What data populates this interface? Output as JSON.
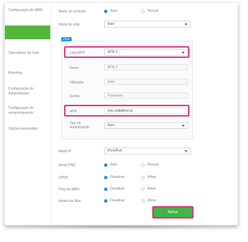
{
  "sidebar": {
    "items": [
      {
        "label": "Configuração de WAN"
      },
      {
        "label": ""
      },
      {
        "label": "Operadores de rede"
      },
      {
        "label": "Roaming"
      },
      {
        "label": "Configuração do Administrador"
      },
      {
        "label": "Configuração de armazenamento"
      },
      {
        "label": "Opções avançadas"
      }
    ]
  },
  "conn_mode": {
    "label": "Modo de conexão",
    "opt_auto": "Auto",
    "opt_manual": "Manual"
  },
  "network_mode": {
    "label": "Modo de rede",
    "value": "Auto"
  },
  "panel": {
    "tag": "Perfil"
  },
  "apn_list": {
    "label": "Lista APN",
    "value": "APN 2"
  },
  "name": {
    "label": "Nome",
    "value": "APN 2"
  },
  "user": {
    "label": "Utilizador",
    "value": "User"
  },
  "password": {
    "label": "Senha",
    "value": "Password"
  },
  "apn": {
    "label": "APN",
    "value": "vivo.vodafone.pt"
  },
  "auth_type": {
    "label": "Tipo de Autenticação",
    "value": "Auto"
  },
  "ip_mode": {
    "label": "Modo IP",
    "value": "IPv4/IPv6"
  },
  "dns_mode": {
    "label": "Modo DNS",
    "opt_on": "Auto",
    "opt_off": "Manual"
  },
  "upnp": {
    "label": "UPNP",
    "opt_on": "Desativar",
    "opt_off": "Ativar"
  },
  "ping_wan": {
    "label": "Ping da WAN",
    "opt_on": "Desativar",
    "opt_off": "Ativar"
  },
  "admin_wan": {
    "label": "Admin da Wan",
    "opt_on": "Desativar",
    "opt_off": "Ativar"
  },
  "apply_button": "Aplicar",
  "colors": {
    "accent": "#1f8fe0",
    "highlight": "#e0317d",
    "green": "#3fb548"
  }
}
